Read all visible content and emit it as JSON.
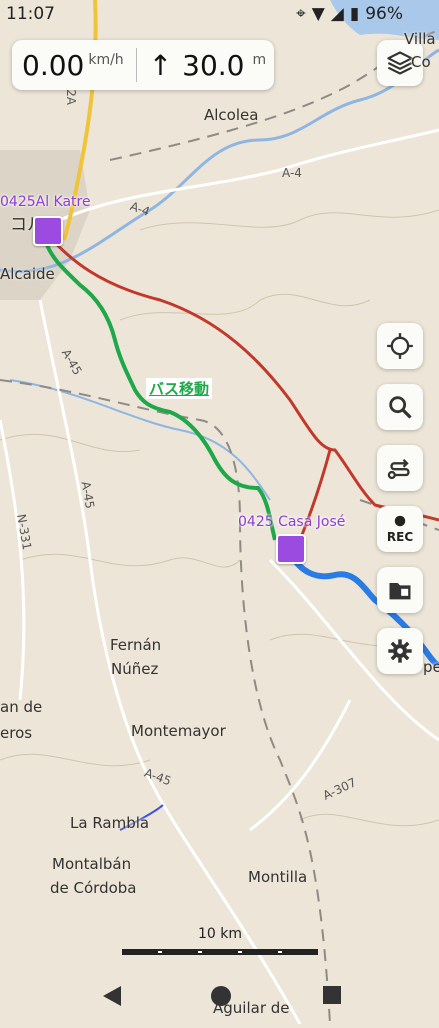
{
  "status_bar": {
    "time": "11:07",
    "battery": "96%"
  },
  "speed_panel": {
    "speed_value": "0.00",
    "speed_unit": "km/h",
    "altitude_arrow": "↑",
    "altitude_value": "30.0",
    "altitude_unit": "m"
  },
  "places": [
    {
      "name": "Alcolea",
      "kind": "town"
    },
    {
      "name": "Fernán",
      "kind": "town"
    },
    {
      "name": "Núñez",
      "kind": "town"
    },
    {
      "name": "Montemayor",
      "kind": "town"
    },
    {
      "name": "La Rambla",
      "kind": "town"
    },
    {
      "name": "Montalbán",
      "kind": "town"
    },
    {
      "name": "de Córdoba",
      "kind": "town"
    },
    {
      "name": "Montilla",
      "kind": "town"
    },
    {
      "name": "Aguilar de",
      "kind": "town"
    },
    {
      "name": "Alcaide",
      "kind": "town"
    },
    {
      "name": "an de",
      "kind": "town"
    },
    {
      "name": "eros",
      "kind": "town"
    },
    {
      "name": "コルバ",
      "kind": "town"
    },
    {
      "name": "Villa",
      "kind": "town"
    },
    {
      "name": "Co",
      "kind": "town"
    },
    {
      "name": "pe",
      "kind": "town"
    }
  ],
  "roads": [
    "A-4",
    "A-4",
    "A-45",
    "A-45",
    "A-45",
    "N-331",
    "A-307",
    "2A"
  ],
  "pois": {
    "start": "0425Al Katre",
    "end": "0425 Casa José"
  },
  "route_label": "バス移動",
  "scale": "10 km",
  "colors": {
    "route_green": "#1fa84a",
    "track_red": "#c0392b",
    "track_blue": "#2a7be4",
    "poi_purple": "#9b4be0",
    "map_bg": "#ede6d8"
  },
  "buttons": [
    {
      "name": "layers-icon"
    },
    {
      "name": "my-location-icon"
    },
    {
      "name": "search-icon"
    },
    {
      "name": "route-icon"
    },
    {
      "name": "record-icon",
      "label": "REC"
    },
    {
      "name": "saved-items-icon"
    },
    {
      "name": "settings-icon"
    }
  ]
}
